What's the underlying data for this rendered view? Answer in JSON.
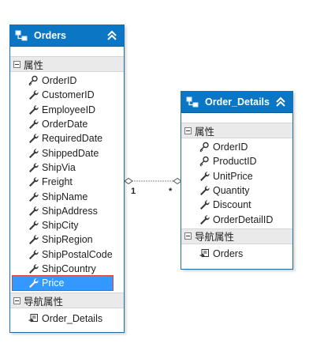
{
  "entities": [
    {
      "title": "Orders",
      "properties_label": "属性",
      "properties": [
        "OrderID",
        "CustomerID",
        "EmployeeID",
        "OrderDate",
        "RequiredDate",
        "ShippedDate",
        "ShipVia",
        "Freight",
        "ShipName",
        "ShipAddress",
        "ShipCity",
        "ShipRegion",
        "ShipPostalCode",
        "ShipCountry",
        "Price"
      ],
      "nav_label": "导航属性",
      "nav": [
        "Order_Details"
      ]
    },
    {
      "title": "Order_Details",
      "properties_label": "属性",
      "properties": [
        "OrderID",
        "ProductID",
        "UnitPrice",
        "Quantity",
        "Discount",
        "OrderDetailID"
      ],
      "nav_label": "导航属性",
      "nav": [
        "Orders"
      ]
    }
  ],
  "association": {
    "left_multiplicity": "1",
    "right_multiplicity": "*"
  },
  "colors": {
    "header": "#0a76c4",
    "selection": "#3399ff",
    "highlight_border": "#e0413a"
  }
}
